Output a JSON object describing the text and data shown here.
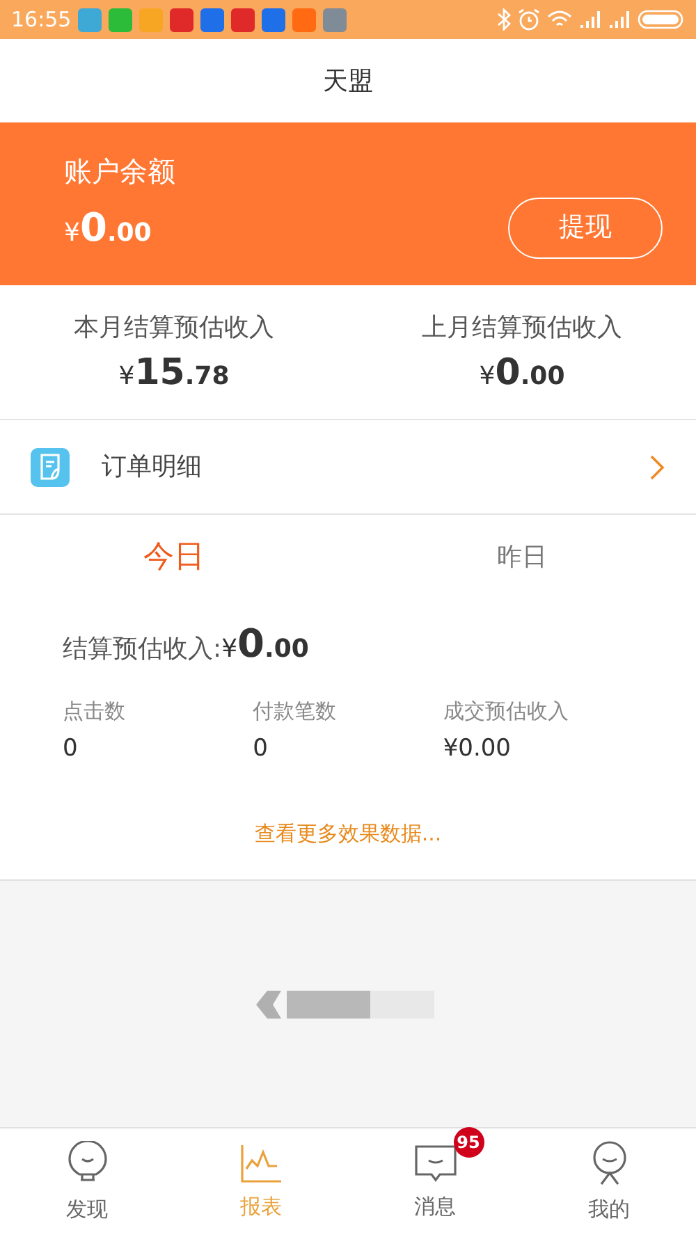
{
  "status_bar": {
    "time": "16:55",
    "notification_icons": [
      {
        "color": "#3fa9d6"
      },
      {
        "color": "#2dbb3a"
      },
      {
        "color": "#f6a623"
      },
      {
        "color": "#e02a2a"
      },
      {
        "color": "#1f6fe8"
      },
      {
        "color": "#e02a2a"
      },
      {
        "color": "#1f6fe8"
      },
      {
        "color": "#ff6a13"
      },
      {
        "color": "#7f8c97"
      }
    ]
  },
  "header": {
    "title": "天盟"
  },
  "balance": {
    "label": "账户余额",
    "amount": {
      "currency": "¥",
      "integer": "0",
      "decimal": ".00"
    },
    "button": "提现"
  },
  "summary": [
    {
      "label": "本月结算预估收入",
      "amount": {
        "currency": "¥",
        "integer": "15",
        "decimal": ".78"
      }
    },
    {
      "label": "上月结算预估收入",
      "amount": {
        "currency": "¥",
        "integer": "0",
        "decimal": ".00"
      }
    }
  ],
  "order_row": {
    "label": "订单明细"
  },
  "tabs": [
    {
      "label": "今日",
      "selected": true
    },
    {
      "label": "昨日",
      "selected": false
    }
  ],
  "settled": {
    "label": "结算预估收入:",
    "amount": {
      "currency": "¥",
      "integer": "0",
      "decimal": ".00"
    }
  },
  "metrics": [
    {
      "label": "点击数",
      "value": "0"
    },
    {
      "label": "付款笔数",
      "value": "0"
    },
    {
      "label": "成交预估收入",
      "value": "¥0.00"
    }
  ],
  "more_link": "查看更多效果数据...",
  "bottom_nav": [
    {
      "label": "发现",
      "kind": "bulb",
      "selected": false
    },
    {
      "label": "报表",
      "kind": "chart",
      "selected": true
    },
    {
      "label": "消息",
      "kind": "message",
      "selected": false,
      "badge": "95"
    },
    {
      "label": "我的",
      "kind": "person",
      "selected": false
    }
  ]
}
